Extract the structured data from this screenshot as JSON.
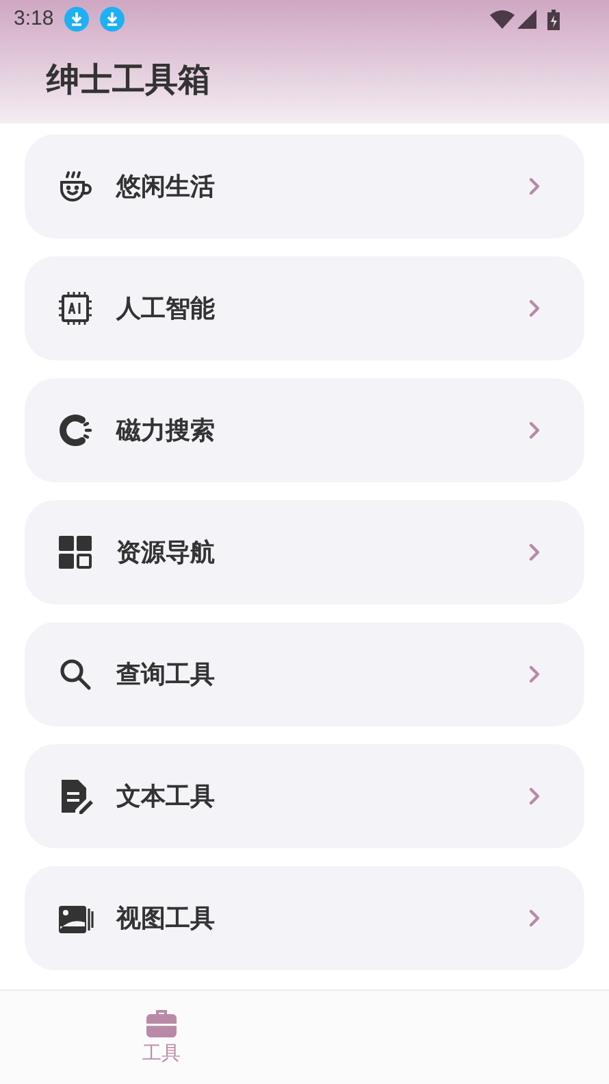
{
  "status_bar": {
    "time": "3:18"
  },
  "header": {
    "title": "绅士工具箱"
  },
  "items": [
    {
      "label": "悠闲生活"
    },
    {
      "label": "人工智能"
    },
    {
      "label": "磁力搜索"
    },
    {
      "label": "资源导航"
    },
    {
      "label": "查询工具"
    },
    {
      "label": "文本工具"
    },
    {
      "label": "视图工具"
    }
  ],
  "bottom_nav": [
    {
      "label": "工具",
      "selected": true
    }
  ]
}
